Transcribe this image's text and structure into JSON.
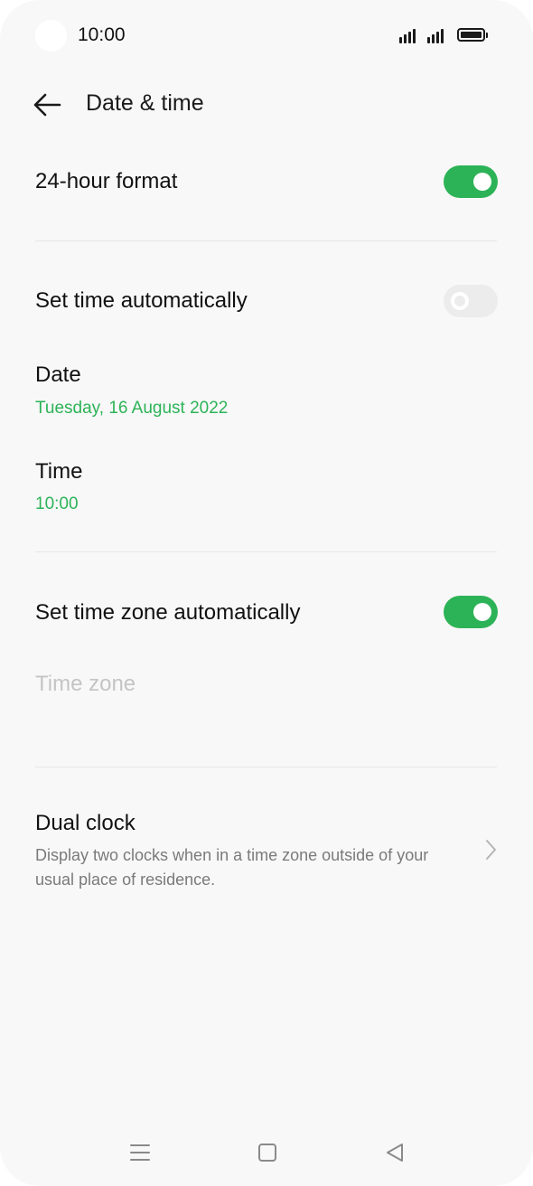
{
  "status_bar": {
    "time": "10:00",
    "icons": [
      "camera-cutout",
      "signal-icon",
      "signal-icon",
      "battery-icon"
    ]
  },
  "header": {
    "back_icon": "arrow-left-icon",
    "title": "Date & time"
  },
  "settings": {
    "hour_format": {
      "label": "24-hour format",
      "enabled": true
    },
    "auto_time": {
      "label": "Set time automatically",
      "enabled": false
    },
    "date": {
      "label": "Date",
      "value": "Tuesday, 16 August 2022"
    },
    "time": {
      "label": "Time",
      "value": "10:00"
    },
    "auto_timezone": {
      "label": "Set time zone automatically",
      "enabled": true
    },
    "timezone": {
      "label": "Time zone",
      "disabled": true
    },
    "dual_clock": {
      "label": "Dual clock",
      "description": "Display two clocks when in a time zone outside of your usual place of residence.",
      "icon": "chevron-right-icon"
    }
  },
  "nav_bar": {
    "items": [
      "menu-icon",
      "home-icon",
      "back-triangle-icon"
    ]
  },
  "colors": {
    "accent": "#2db357",
    "background": "#f8f8f8",
    "text": "#111111",
    "secondary_text": "#7a7a7a",
    "disabled_text": "#c4c4c4"
  }
}
